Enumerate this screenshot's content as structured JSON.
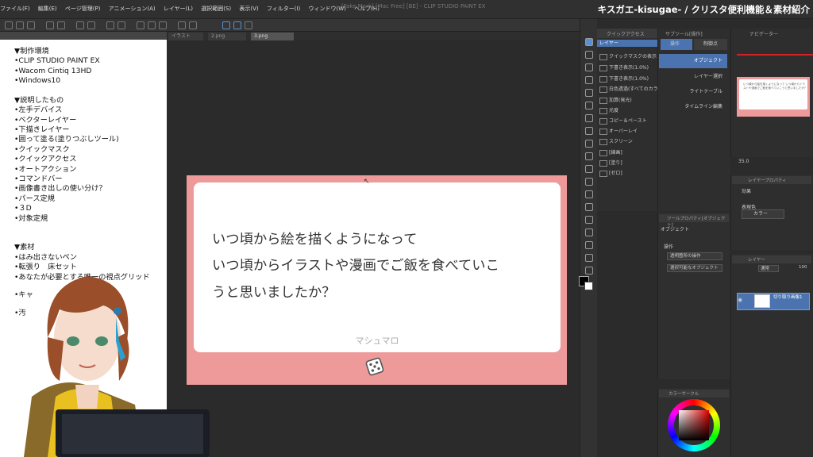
{
  "menubar": {
    "items": [
      "ファイル(F)",
      "編集(E)",
      "ページ管理(P)",
      "アニメーション(A)",
      "レイヤー(L)",
      "選択範囲(S)",
      "表示(V)",
      "フィルター(I)",
      "ウィンドウ(W)",
      "ヘルプ(H)"
    ],
    "window_title": "[Fake Mark] [Mac Free] [BE] - CLIP STUDIO PAINT EX"
  },
  "channel_title": "キスガエ-kisugae- / クリスタ便利機能＆素材紹介",
  "document_tabs": [
    "イラスト",
    "2.png",
    "3.png"
  ],
  "notes": {
    "lines": [
      "▼制作環境",
      "•CLIP STUDIO PAINT EX",
      "•Wacom Cintiq 13HD",
      "•Windows10",
      "",
      "▼説明したもの",
      "•左手デバイス",
      "•ベクターレイヤー",
      "•下描きレイヤー",
      "•囲って塗る(塗りつぶしツール)",
      "•クイックマスク",
      "•クイックアクセス",
      "•オートアクション",
      "•コマンドバー",
      "•画像書き出しの使い分け？",
      "•パース定規",
      "•３D",
      "•対象定規",
      "",
      "",
      "▼素材",
      "•はみ出さないペン",
      "•転張り　床セット",
      "•あなたが必要とする唯一の視点グリッド",
      "",
      "•キャ　　　　　　化",
      "",
      "•汚"
    ]
  },
  "card": {
    "question_lines": [
      "いつ頃から絵を描くようになって",
      "いつ頃からイラストや漫画でご飯を食べていこ",
      "うと思いましたか？"
    ],
    "brand": "マシュマロ",
    "dice_icon": "dice-icon"
  },
  "quick_access": {
    "header": "クイックアクセス",
    "selected": "レイヤー",
    "items": [
      "クイックマスクの表示",
      "下書き表示(1.0%)",
      "下書き表示(1.0%)",
      "白色透過(すべてのカラー)",
      "加算(発光)",
      "光度",
      "コピー＆ペースト",
      "オーバーレイ",
      "スクリーン",
      "[線画]",
      "[塗り]",
      "[ゼロ]"
    ]
  },
  "sub_tool": {
    "header": "サブツール[操作]",
    "tabs": [
      "操作",
      "制御点"
    ],
    "items": [
      "オブジェクト",
      "レイヤー選択",
      "ライトテーブル",
      "タイムライン編集"
    ]
  },
  "tool_property": {
    "header": "ツールプロパティ[オブジェクト]",
    "object": "オブジェクト",
    "operation": "操作",
    "dropdowns": [
      "透明箇所の操作",
      "選択可能なオブジェクト"
    ]
  },
  "color_wheel": {
    "header": "カラーサークル",
    "main_color": "#000000",
    "sub_color": "#ffffff"
  },
  "navigator": {
    "header": "ナビゲーター",
    "preview_text": "いつ頃から絵を描くようになって いつ頃からイラストや漫画でご飯を食べていこうと思いましたか？",
    "zoom": "35.0"
  },
  "layer_property": {
    "header": "レイヤープロパティ",
    "effect_label": "効果",
    "expression_color_label": "表現色",
    "expression_color": "カラー"
  },
  "layers": {
    "header": "レイヤー",
    "blend_mode": "通常",
    "opacity": "100",
    "layer_name": "切り取り画像1"
  },
  "colors": {
    "card_pink": "#ee9a9a",
    "selection_blue": "#4a73b0",
    "nav_red_line": "#d32222"
  }
}
